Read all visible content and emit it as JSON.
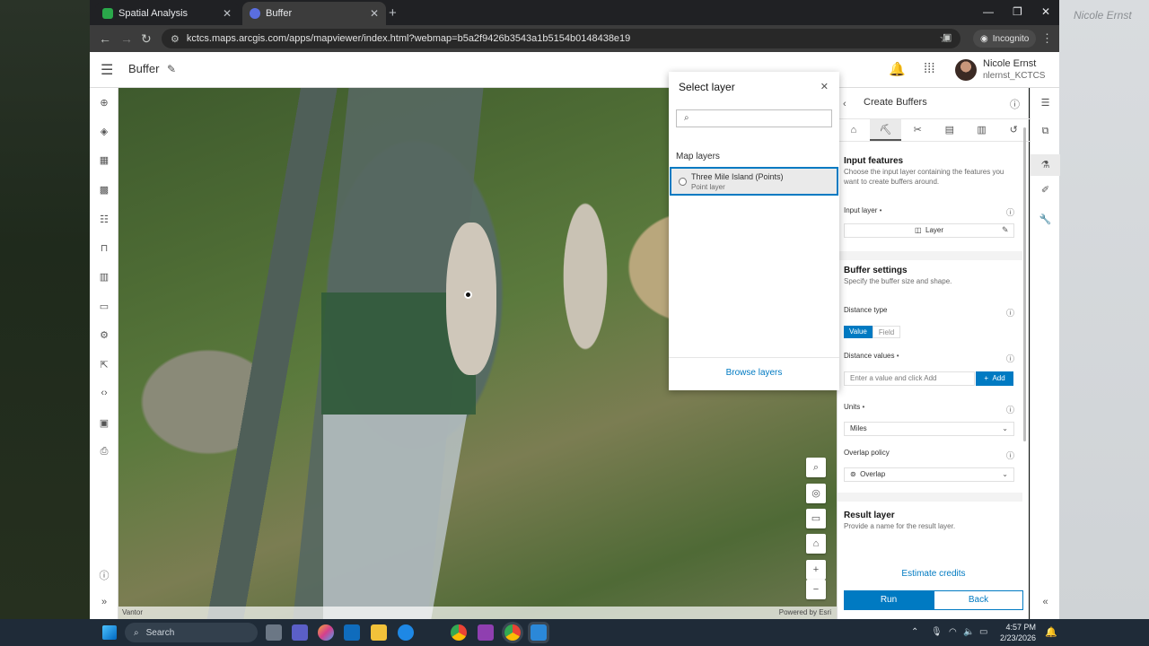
{
  "browser": {
    "tabs": [
      {
        "label": "Spatial Analysis",
        "active": false
      },
      {
        "label": "Buffer",
        "active": true
      }
    ],
    "url": "kctcs.maps.arcgis.com/apps/mapviewer/index.html?webmap=b5a2f9426b3543a1b5154b0148438e19",
    "incognito_label": "Incognito"
  },
  "app": {
    "title": "Buffer",
    "user": {
      "name": "Nicole Ernst",
      "username": "nlernst_KCTCS"
    }
  },
  "map": {
    "attribution_left": "Vantor",
    "attribution_right": "Powered by Esri"
  },
  "select_layer": {
    "title": "Select layer",
    "search_placeholder": "",
    "section_label": "Map layers",
    "items": [
      {
        "name": "Three Mile Island (Points)",
        "type": "Point layer",
        "selected": false
      }
    ],
    "browse_label": "Browse layers"
  },
  "create_buffers": {
    "header": "Create Buffers",
    "input_features": {
      "title": "Input features",
      "desc": "Choose the input layer containing the features you want to create buffers around.",
      "input_layer_label": "Input layer",
      "layer_button": "Layer"
    },
    "buffer_settings": {
      "title": "Buffer settings",
      "desc": "Specify the buffer size and shape.",
      "distance_type_label": "Distance type",
      "distance_type_options": [
        "Value",
        "Field"
      ],
      "distance_type_selected": "Value",
      "distance_values_label": "Distance values",
      "distance_values_placeholder": "Enter a value and click Add",
      "add_label": "Add",
      "units_label": "Units",
      "units_value": "Miles",
      "overlap_label": "Overlap policy",
      "overlap_value": "Overlap"
    },
    "result_layer": {
      "title": "Result layer",
      "desc": "Provide a name for the result layer."
    },
    "estimate_label": "Estimate credits",
    "run_label": "Run",
    "back_label": "Back"
  },
  "taskbar": {
    "search_label": "Search",
    "time": "4:57 PM",
    "date": "2/23/2026"
  },
  "bg_right_text": "Nicole Ernst"
}
